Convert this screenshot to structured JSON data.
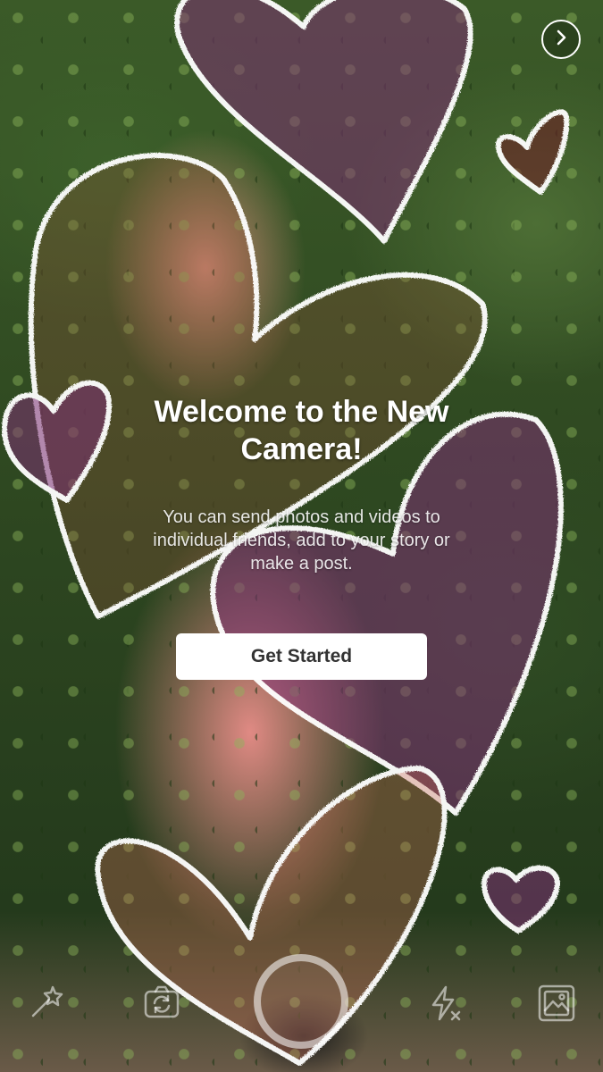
{
  "welcome": {
    "title_line1": "Welcome to the New",
    "title_line2": "Camera!",
    "body_line1": "You can send photos and videos to",
    "body_line2": "individual friends, add to your story or",
    "body_line3": "make a post.",
    "button_label": "Get Started"
  },
  "icons": {
    "next": "chevron-right-icon",
    "effects": "magic-wand-icon",
    "flip_camera": "camera-flip-icon",
    "shutter": "shutter-icon",
    "flash": "flash-off-icon",
    "gallery": "gallery-icon"
  },
  "colors": {
    "button_bg": "#ffffff",
    "button_text": "#333333",
    "heart_outline": "#ffffff",
    "heart_fill": "#7a2d6a"
  }
}
